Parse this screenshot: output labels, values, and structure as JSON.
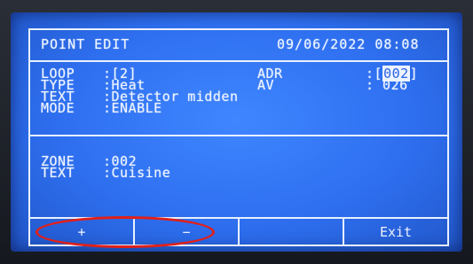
{
  "header": {
    "title": "POINT EDIT",
    "datetime": "09/06/2022 08:08"
  },
  "point": {
    "loop_label": "LOOP",
    "loop_value": ":[2]",
    "type_label": "TYPE",
    "type_value": ":Heat",
    "text_label": "TEXT",
    "text_value": ":Detector midden",
    "mode_label": "MODE",
    "mode_value": ":ENABLE",
    "adr_label": "ADR",
    "adr_prefix": ":[",
    "adr_value": "002",
    "adr_suffix": "]",
    "av_label": "AV",
    "av_value": ": 026"
  },
  "zone": {
    "zone_label": "ZONE",
    "zone_value": ":002",
    "text_label": "TEXT",
    "text_value": ":Cuisine"
  },
  "softkeys": {
    "plus": "+",
    "minus": "−",
    "blank": "",
    "exit": "Exit"
  },
  "colors": {
    "screen": "#2e6ff0",
    "text": "#edf3ff",
    "annotation": "#e0201a"
  }
}
